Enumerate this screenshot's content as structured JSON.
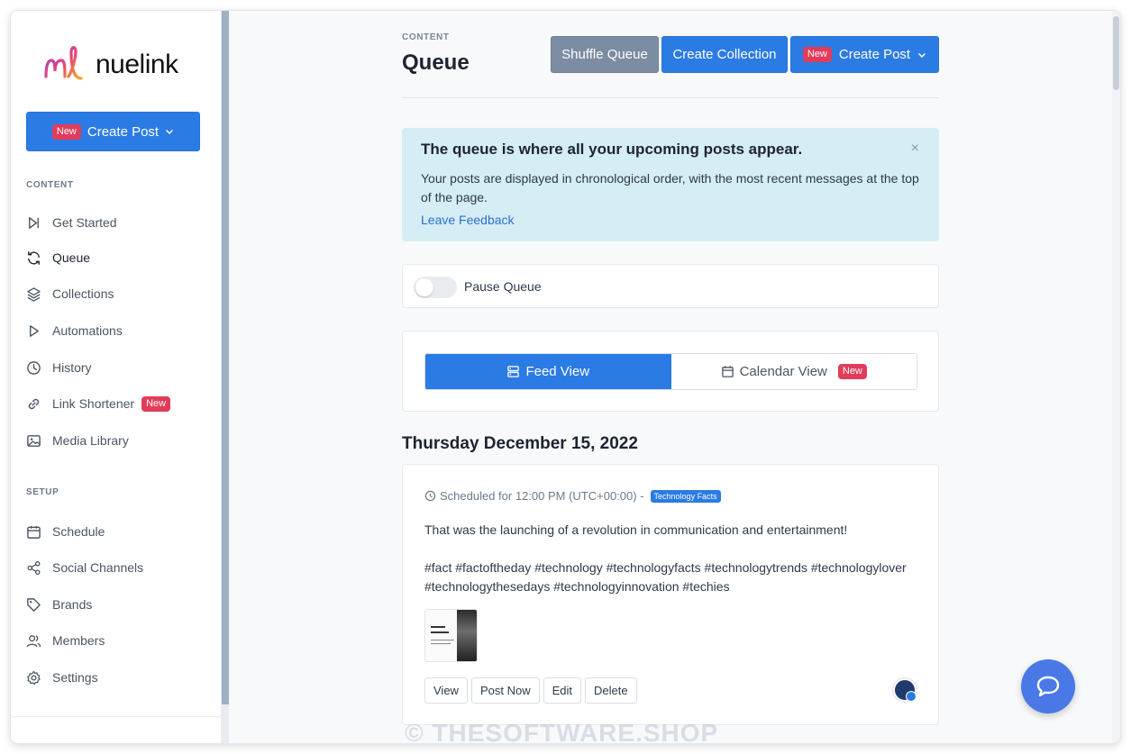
{
  "brand": {
    "name": "nuelink"
  },
  "sidebar": {
    "create_button": {
      "badge": "New",
      "label": "Create Post"
    },
    "sections": [
      {
        "label": "CONTENT"
      },
      {
        "label": "SETUP"
      }
    ],
    "content_items": [
      {
        "label": "Get Started",
        "icon": "play-step-icon"
      },
      {
        "label": "Queue",
        "icon": "refresh-icon"
      },
      {
        "label": "Collections",
        "icon": "layers-icon"
      },
      {
        "label": "Automations",
        "icon": "play-icon"
      },
      {
        "label": "History",
        "icon": "clock-icon"
      },
      {
        "label": "Link Shortener",
        "icon": "link-icon",
        "badge": "New"
      },
      {
        "label": "Media Library",
        "icon": "image-icon"
      }
    ],
    "setup_items": [
      {
        "label": "Schedule",
        "icon": "calendar-icon"
      },
      {
        "label": "Social Channels",
        "icon": "share-icon"
      },
      {
        "label": "Brands",
        "icon": "tag-icon"
      },
      {
        "label": "Members",
        "icon": "users-icon"
      },
      {
        "label": "Settings",
        "icon": "gear-icon"
      }
    ]
  },
  "header": {
    "eyebrow": "CONTENT",
    "title": "Queue",
    "shuffle_label": "Shuffle Queue",
    "collection_label": "Create Collection",
    "create_badge": "New",
    "create_label": "Create Post"
  },
  "info": {
    "title": "The queue is where all your upcoming posts appear.",
    "body": "Your posts are displayed in chronological order, with the most recent messages at the top of the page.",
    "link": "Leave Feedback",
    "close": "×"
  },
  "pause": {
    "label": "Pause Queue",
    "enabled": false
  },
  "views": {
    "feed_label": "Feed View",
    "calendar_label": "Calendar View",
    "calendar_badge": "New"
  },
  "feed": {
    "date": "Thursday December 15, 2022",
    "post": {
      "scheduled": "Scheduled for 12:00 PM (UTC+00:00) -",
      "tag": "Technology Facts",
      "text": "That was the launching of a revolution in communication and entertainment!",
      "hashtags": "#fact #factoftheday #technology #technologyfacts #technologytrends #technologylover #technologythesedays #technologyinnovation #techies",
      "actions": {
        "view": "View",
        "post_now": "Post Now",
        "edit": "Edit",
        "delete": "Delete"
      }
    }
  },
  "watermark": "© THESOFTWARE.SHOP",
  "colors": {
    "primary": "#2b7be4",
    "badge": "#e23c5a",
    "secondary": "#7b8ca3",
    "info_bg": "#d5edf5"
  }
}
